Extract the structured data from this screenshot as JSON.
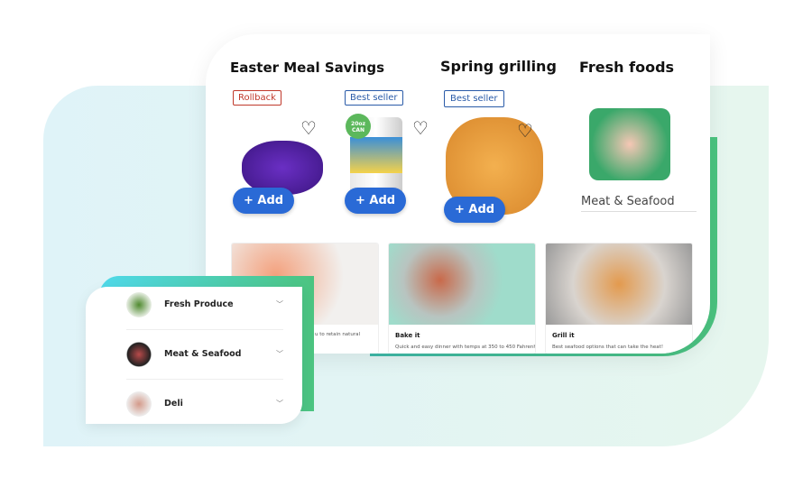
{
  "sections": {
    "easter": "Easter Meal Savings",
    "spring": "Spring grilling",
    "fresh": "Fresh foods"
  },
  "badges": [
    "Rollback",
    "Best seller",
    "Best seller"
  ],
  "add_label": "+ Add",
  "fresh_category": "Meat & Seafood",
  "can_label": "20oz CAN",
  "recipes": [
    {
      "title": "",
      "desc": "u to retain natural"
    },
    {
      "title": "Bake it",
      "desc": "Quick and easy dinner with temps at 350 to 450 Fahrenheit"
    },
    {
      "title": "Grill it",
      "desc": "Best seafood options that can take the heat!"
    }
  ],
  "panel": [
    {
      "label": "Fresh Produce"
    },
    {
      "label": "Meat & Seafood"
    },
    {
      "label": "Deli"
    }
  ],
  "colors": {
    "accent": "#2a6ad6",
    "rollback": "#c0392b",
    "gradient_start": "#4fd9ea",
    "gradient_end": "#4cc480"
  }
}
